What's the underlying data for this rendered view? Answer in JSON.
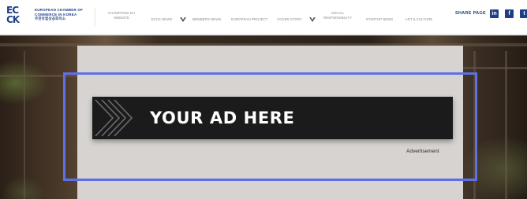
{
  "header": {
    "logo": {
      "mark_lines": [
        "EC",
        "CK"
      ],
      "text_lines": [
        "EUROPEAN CHAMBER OF",
        "COMMERCE IN KOREA",
        "주한유럽상공회의소"
      ]
    },
    "nav": [
      {
        "label_lines": [
          "CHAMPIONS EU",
          "WEBSITE"
        ]
      },
      {
        "label_lines": [
          "ECCK NEWS"
        ],
        "has_dropdown": true
      },
      {
        "label_lines": [
          "MEMBERS NEWS"
        ]
      },
      {
        "label_lines": [
          "EUROPEAN PROJECT"
        ]
      },
      {
        "label_lines": [
          "COVER STORY"
        ],
        "has_dropdown": true
      },
      {
        "label_lines": [
          "SOCIAL",
          "RESPONSIBILITY"
        ]
      },
      {
        "label_lines": [
          "STARTUP NEWS"
        ]
      },
      {
        "label_lines": [
          "ART & CULTURE"
        ]
      }
    ],
    "share": {
      "label": "SHARE PAGE",
      "buttons": [
        {
          "icon": "linkedin-icon",
          "glyph": "in"
        },
        {
          "icon": "facebook-icon",
          "glyph": "f"
        },
        {
          "icon": "twitter-icon",
          "glyph": "t"
        }
      ]
    }
  },
  "ad": {
    "headline": "YOUR AD HERE",
    "caption": "Advertisement"
  },
  "colors": {
    "brand": "#1d3f87",
    "banner": "#1b1b1b",
    "panel": "#d6d3d0",
    "highlight": "#5f6fe8"
  }
}
